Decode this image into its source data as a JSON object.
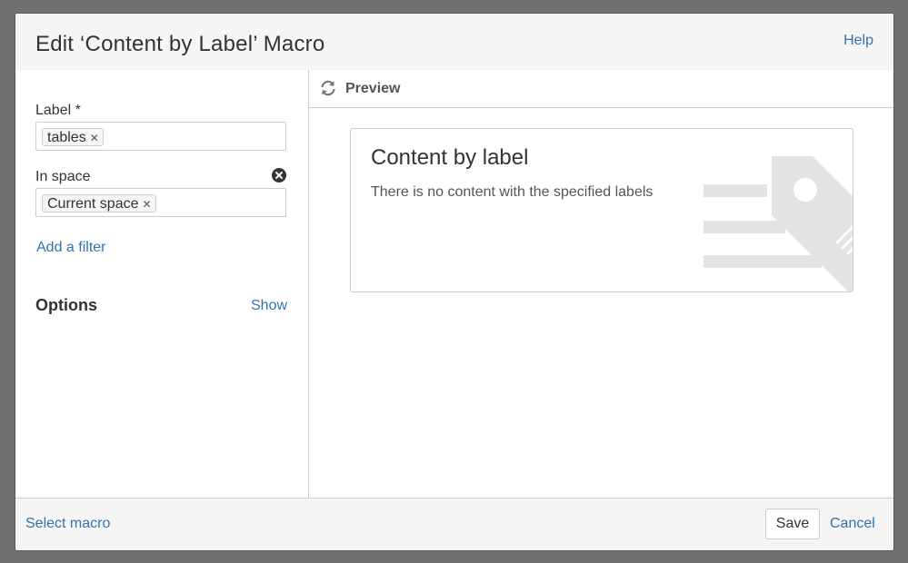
{
  "dialog": {
    "title": "Edit ‘Content by Label’ Macro",
    "help_label": "Help"
  },
  "form": {
    "label_field": {
      "label": "Label *",
      "tags": [
        "tables"
      ]
    },
    "space_field": {
      "label": "In space",
      "tags": [
        "Current space"
      ]
    },
    "add_filter_label": "Add a filter",
    "options_label": "Options",
    "show_label": "Show"
  },
  "preview": {
    "label": "Preview",
    "card_title": "Content by label",
    "card_message": "There is no content with the specified labels"
  },
  "footer": {
    "select_macro_label": "Select macro",
    "save_label": "Save",
    "cancel_label": "Cancel"
  },
  "icons": {
    "tag_remove": "x-icon",
    "clear": "clear-circle-icon",
    "refresh": "refresh-icon",
    "illustration": "label-tag-illustration"
  },
  "colors": {
    "link": "#3572b0",
    "text": "#333333",
    "backdrop": "#707070",
    "illustration": "#e3e3e3"
  }
}
